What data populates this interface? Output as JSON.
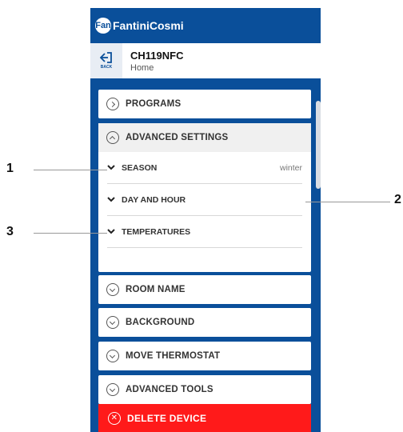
{
  "app": {
    "logo": "FantiniCosmi",
    "logo_badge": "Fan"
  },
  "header": {
    "back_label": "BACK",
    "device_name": "CH119NFC",
    "location": "Home"
  },
  "menu": {
    "programs": "PROGRAMS",
    "advanced_settings": "ADVANCED SETTINGS",
    "sub_items": [
      {
        "label": "SEASON",
        "value": "winter"
      },
      {
        "label": "DAY AND HOUR",
        "value": ""
      },
      {
        "label": "TEMPERATURES",
        "value": ""
      }
    ],
    "room_name": "ROOM NAME",
    "background": "BACKGROUND",
    "move_thermostat": "MOVE THERMOSTAT",
    "advanced_tools": "ADVANCED TOOLS",
    "delete_device": "DELETE DEVICE"
  },
  "callouts": [
    "1",
    "2",
    "3"
  ],
  "colors": {
    "brand_blue": "#0a4f9a",
    "delete_red": "#ff1a1a"
  }
}
